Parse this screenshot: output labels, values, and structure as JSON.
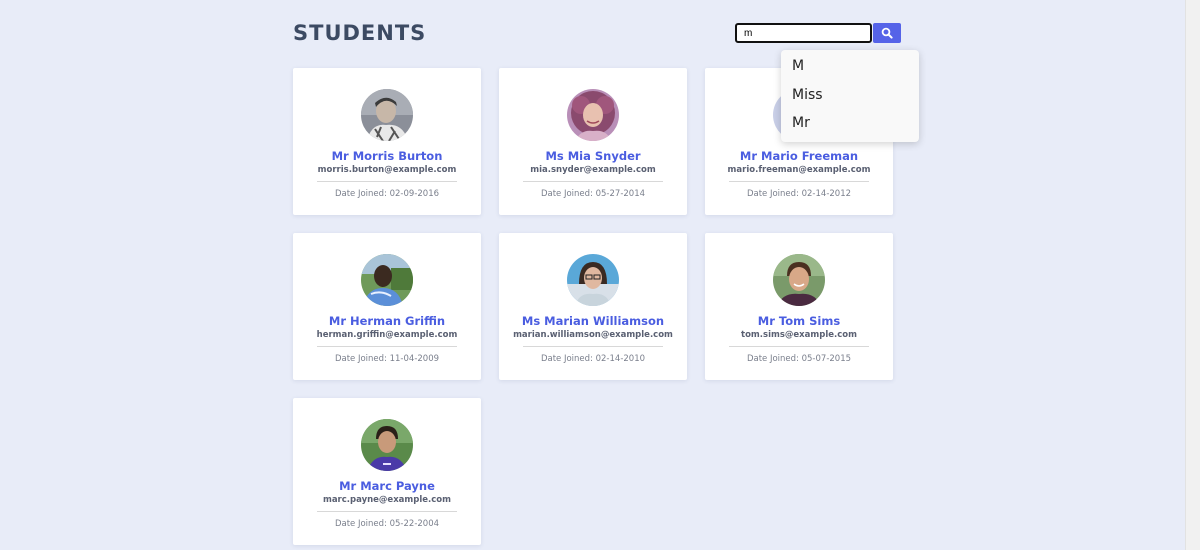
{
  "header": {
    "title": "STUDENTS"
  },
  "search": {
    "value": "m",
    "button_icon": "search-icon",
    "accent_color": "#5563e8"
  },
  "suggestions": [
    "M",
    "Miss",
    "Mr"
  ],
  "students": [
    {
      "name": "Mr Morris Burton",
      "email": "morris.burton@example.com",
      "date_joined": "Date Joined: 02-09-2016",
      "avatar_icon": "avatar"
    },
    {
      "name": "Ms Mia Snyder",
      "email": "mia.snyder@example.com",
      "date_joined": "Date Joined: 05-27-2014",
      "avatar_icon": "avatar"
    },
    {
      "name": "Mr Mario Freeman",
      "email": "mario.freeman@example.com",
      "date_joined": "Date Joined: 02-14-2012",
      "avatar_icon": "avatar"
    },
    {
      "name": "Mr Herman Griffin",
      "email": "herman.griffin@example.com",
      "date_joined": "Date Joined: 11-04-2009",
      "avatar_icon": "avatar"
    },
    {
      "name": "Ms Marian Williamson",
      "email": "marian.williamson@example.com",
      "date_joined": "Date Joined: 02-14-2010",
      "avatar_icon": "avatar"
    },
    {
      "name": "Mr Tom Sims",
      "email": "tom.sims@example.com",
      "date_joined": "Date Joined: 05-07-2015",
      "avatar_icon": "avatar"
    },
    {
      "name": "Mr Marc Payne",
      "email": "marc.payne@example.com",
      "date_joined": "Date Joined: 05-22-2004",
      "avatar_icon": "avatar"
    }
  ],
  "colors": {
    "background": "#e8ecf8",
    "name_accent": "#4a5de0",
    "title": "#3c4a63"
  }
}
